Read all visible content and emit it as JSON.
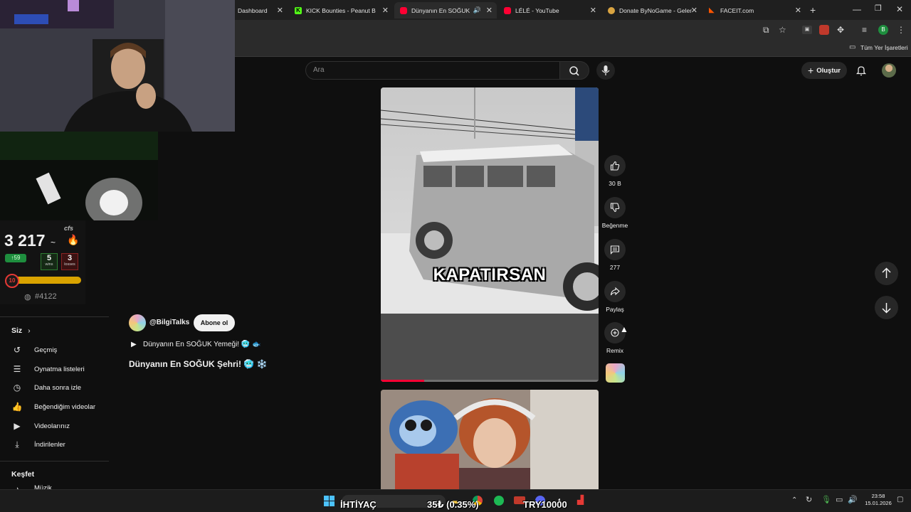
{
  "browser": {
    "tabs": [
      {
        "title": "Dashboard",
        "color": "#53fc18"
      },
      {
        "title": "KICK Bounties - Peanut Butt",
        "color": "#53fc18"
      },
      {
        "title": "Dünyanın En SOĞUK Şe",
        "color": "#ff0033",
        "active": true
      },
      {
        "title": "LÉLÉ - YouTube",
        "color": "#ff0033"
      },
      {
        "title": "Donate ByNoGame - Gelen",
        "color": "#d9a441"
      },
      {
        "title": "FACEIT.com",
        "color": "#ff5500"
      }
    ],
    "bookmarks_label": "Tüm Yer İşaretleri",
    "profile_initial": "B"
  },
  "youtube": {
    "search_placeholder": "Ara",
    "create_label": "Oluştur",
    "sidebar": {
      "you_label": "Siz",
      "items": [
        {
          "label": "Geçmiş",
          "icon": "history-icon"
        },
        {
          "label": "Oynatma listeleri",
          "icon": "playlist-icon"
        },
        {
          "label": "Daha sonra izle",
          "icon": "clock-icon"
        },
        {
          "label": "Beğendiğim videolar",
          "icon": "thumbs-up-icon"
        },
        {
          "label": "Videolarınız",
          "icon": "video-icon"
        },
        {
          "label": "İndirilenler",
          "icon": "download-icon"
        }
      ],
      "explore_label": "Keşfet",
      "cut_label": "Müzik"
    },
    "short": {
      "channel": "@BilgiTalks",
      "subscribe_label": "Abone ol",
      "playlist_title": "Dünyanın En SOĞUK Yemeği! 🥶 🐟",
      "title": "Dünyanın En SOĞUK Şehri! 🥶 ❄️",
      "caption": "KAPATIRSAN",
      "likes": "30 B",
      "dislike_label": "Beğenme",
      "comments": "277",
      "share_label": "Paylaş",
      "remix_label": "Remix",
      "progress": 0.2
    }
  },
  "overlay": {
    "elo": "3 217",
    "elo_change": "59",
    "wins": "5",
    "wins_label": "wins",
    "losses": "3",
    "losses_label": "losses",
    "level": "10",
    "rank": "#4122",
    "brand": "cfs"
  },
  "taskbar": {
    "ticker": [
      "İHTİYAÇ",
      "35₺ (0.35%)",
      "TRY10000"
    ],
    "time": "23:58",
    "date": "15.01.2026"
  }
}
